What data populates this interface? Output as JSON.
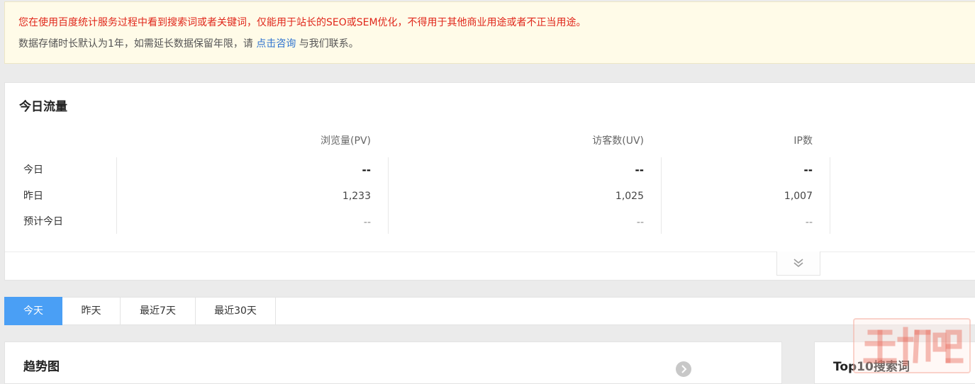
{
  "notice": {
    "line1": "您在使用百度统计服务过程中看到搜索词或者关键词，仅能用于站长的SEO或SEM优化，不得用于其他商业用途或者不正当用途。",
    "line2_prefix": "数据存储时长默认为1年，如需延长数据保留年限，请 ",
    "line2_link": "点击咨询",
    "line2_suffix": " 与我们联系。"
  },
  "traffic": {
    "title": "今日流量",
    "columns": [
      "浏览量(PV)",
      "访客数(UV)",
      "IP数"
    ],
    "rows": [
      {
        "label": "今日",
        "values": [
          "--",
          "--",
          "--"
        ]
      },
      {
        "label": "昨日",
        "values": [
          "1,233",
          "1,025",
          "1,007"
        ]
      },
      {
        "label": "预计今日",
        "values": [
          "--",
          "--",
          "--"
        ]
      }
    ],
    "expand_icon": "double-chevron-down-icon"
  },
  "tabs": {
    "items": [
      "今天",
      "昨天",
      "最近7天",
      "最近30天"
    ],
    "active_index": 0,
    "active_color": "#4a9ff5"
  },
  "trend": {
    "title": "趋势图",
    "arrow_icon": "chevron-right-circle-icon"
  },
  "top10": {
    "title": "Top10搜索词"
  },
  "colors": {
    "notice_bg": "#fffbe8",
    "notice_warning": "#e0271b",
    "link": "#2f74cf",
    "page_bg": "#ebebeb"
  }
}
